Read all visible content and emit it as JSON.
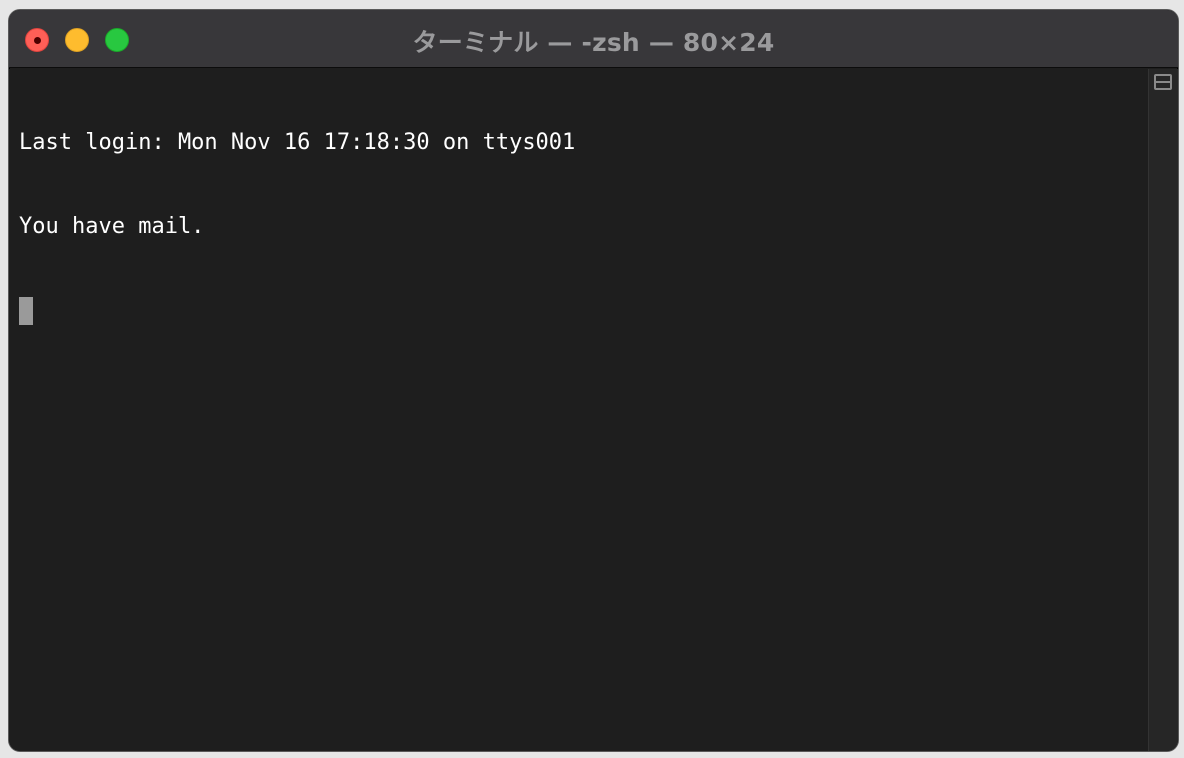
{
  "window": {
    "title": "ターミナル — -zsh — 80×24"
  },
  "terminal": {
    "lines": [
      "Last login: Mon Nov 16 17:18:30 on ttys001",
      "You have mail."
    ]
  },
  "colors": {
    "background": "#1e1e1e",
    "titlebar": "#38373a",
    "text": "#ffffff",
    "cursor": "#9a9a9a",
    "close": "#fe5f57",
    "minimize": "#febc2e",
    "zoom": "#28c840"
  },
  "icons": {
    "split": "split-pane-icon"
  }
}
